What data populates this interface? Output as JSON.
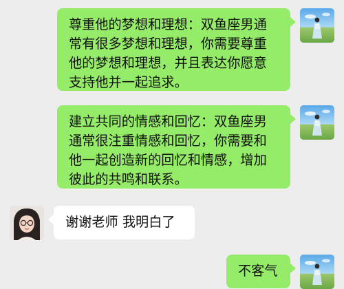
{
  "messages": [
    {
      "sender": "self",
      "text": "尊重他的梦想和理想：双鱼座男通常有很多梦想和理想，你需要尊重他的梦想和理想，并且表达你愿意支持他并一起追求。",
      "avatar_icon": "user-avatar-meadow-icon"
    },
    {
      "sender": "self",
      "text": "建立共同的情感和回忆：双鱼座男通常很注重情感和回忆，你需要和他一起创造新的回忆和情感，增加彼此的共鸣和联系。",
      "avatar_icon": "user-avatar-meadow-icon"
    },
    {
      "sender": "other",
      "text": "谢谢老师 我明白了",
      "avatar_icon": "contact-avatar-girl-glasses-icon"
    },
    {
      "sender": "self",
      "text": "不客气",
      "avatar_icon": "user-avatar-meadow-icon"
    }
  ],
  "colors": {
    "background": "#ededed",
    "outgoing_bubble": "#95ec69",
    "incoming_bubble": "#ffffff"
  }
}
